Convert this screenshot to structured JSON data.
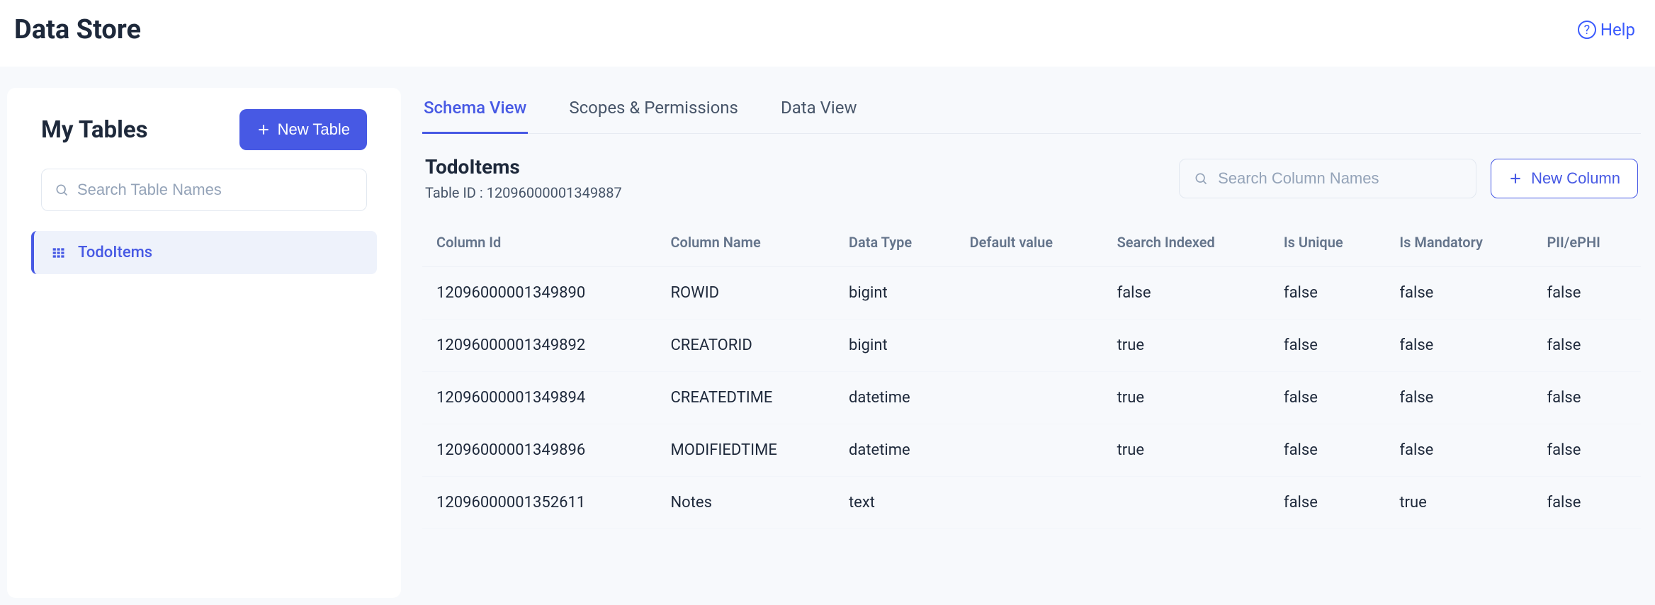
{
  "header": {
    "title": "Data Store",
    "help_label": "Help"
  },
  "sidebar": {
    "title": "My Tables",
    "new_table_label": "New Table",
    "search_placeholder": "Search Table Names",
    "items": [
      {
        "label": "TodoItems"
      }
    ]
  },
  "tabs": [
    {
      "label": "Schema View",
      "active": true
    },
    {
      "label": "Scopes & Permissions",
      "active": false
    },
    {
      "label": "Data View",
      "active": false
    }
  ],
  "current_table": {
    "name": "TodoItems",
    "id_label": "Table ID : 12096000001349887"
  },
  "column_search_placeholder": "Search Column Names",
  "new_column_label": "New Column",
  "columns_headers": [
    "Column Id",
    "Column Name",
    "Data Type",
    "Default value",
    "Search Indexed",
    "Is Unique",
    "Is Mandatory",
    "PII/ePHI"
  ],
  "columns": [
    {
      "id": "12096000001349890",
      "name": "ROWID",
      "type": "bigint",
      "default": "",
      "indexed": "false",
      "unique": "false",
      "mandatory": "false",
      "pii": "false"
    },
    {
      "id": "12096000001349892",
      "name": "CREATORID",
      "type": "bigint",
      "default": "",
      "indexed": "true",
      "unique": "false",
      "mandatory": "false",
      "pii": "false"
    },
    {
      "id": "12096000001349894",
      "name": "CREATEDTIME",
      "type": "datetime",
      "default": "",
      "indexed": "true",
      "unique": "false",
      "mandatory": "false",
      "pii": "false"
    },
    {
      "id": "12096000001349896",
      "name": "MODIFIEDTIME",
      "type": "datetime",
      "default": "",
      "indexed": "true",
      "unique": "false",
      "mandatory": "false",
      "pii": "false"
    },
    {
      "id": "12096000001352611",
      "name": "Notes",
      "type": "text",
      "default": "",
      "indexed": "",
      "unique": "false",
      "mandatory": "true",
      "pii": "false"
    }
  ]
}
